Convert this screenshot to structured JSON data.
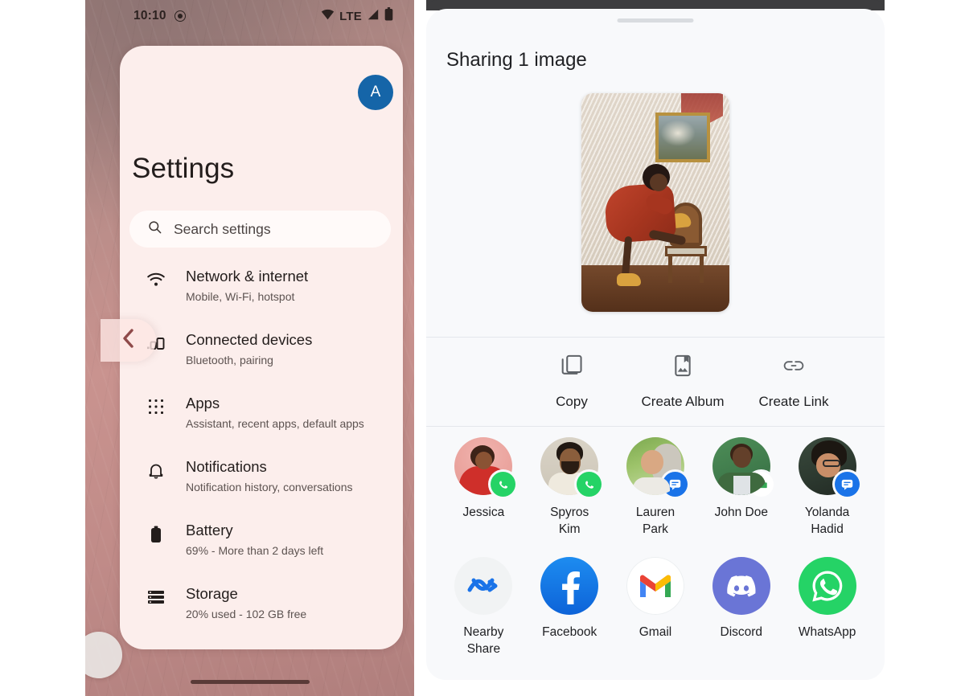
{
  "left_phone": {
    "status_bar": {
      "time": "10:10",
      "record_icon": "record-dot-icon",
      "wifi_icon": "wifi-icon",
      "network_label": "LTE",
      "signal_icon": "signal-bars-icon",
      "battery_icon": "battery-full-icon"
    },
    "account_avatar": {
      "initial": "A",
      "color": "#1565a8"
    },
    "page_title": "Settings",
    "search": {
      "placeholder": "Search settings",
      "icon": "search-icon"
    },
    "back_button": {
      "icon": "chevron-left-icon"
    },
    "items": [
      {
        "icon": "wifi-icon",
        "title": "Network & internet",
        "subtitle": "Mobile, Wi-Fi, hotspot"
      },
      {
        "icon": "connected-devices-icon",
        "title": "Connected devices",
        "subtitle": "Bluetooth, pairing"
      },
      {
        "icon": "apps-grid-icon",
        "title": "Apps",
        "subtitle": "Assistant, recent apps, default apps"
      },
      {
        "icon": "bell-icon",
        "title": "Notifications",
        "subtitle": "Notification history, conversations"
      },
      {
        "icon": "battery-icon",
        "title": "Battery",
        "subtitle": "69% - More than 2 days left"
      },
      {
        "icon": "storage-icon",
        "title": "Storage",
        "subtitle": "20% used - 102 GB free"
      }
    ]
  },
  "right_phone": {
    "sheet_title": "Sharing 1 image",
    "drag_handle": "drag-handle",
    "preview": {
      "alt": "shared-photo-preview"
    },
    "actions": [
      {
        "icon": "copy-icon",
        "label": "Copy"
      },
      {
        "icon": "album-icon",
        "label": "Create Album"
      },
      {
        "icon": "link-icon",
        "label": "Create Link"
      }
    ],
    "contacts": [
      {
        "name": "Jessica",
        "badge": "whatsapp-badge-icon",
        "badge_color": "#25D366"
      },
      {
        "name": "Spyros\nKim",
        "badge": "whatsapp-badge-icon",
        "badge_color": "#25D366"
      },
      {
        "name": "Lauren\nPark",
        "badge": "messages-badge-icon",
        "badge_color": "#1a73e8"
      },
      {
        "name": "John Doe",
        "badge": "chat-bubble-badge-icon",
        "badge_color": "#34A853"
      },
      {
        "name": "Yolanda\nHadid",
        "badge": "messages-badge-icon",
        "badge_color": "#1a73e8"
      }
    ],
    "apps": [
      {
        "name": "Nearby\nShare",
        "icon": "nearby-share-icon",
        "color": "#1a73e8"
      },
      {
        "name": "Facebook",
        "icon": "facebook-icon",
        "color": "#1877F2"
      },
      {
        "name": "Gmail",
        "icon": "gmail-icon",
        "color": "#EA4335"
      },
      {
        "name": "Discord",
        "icon": "discord-icon",
        "color": "#5865F2"
      },
      {
        "name": "WhatsApp",
        "icon": "whatsapp-icon",
        "color": "#25D366"
      }
    ]
  }
}
